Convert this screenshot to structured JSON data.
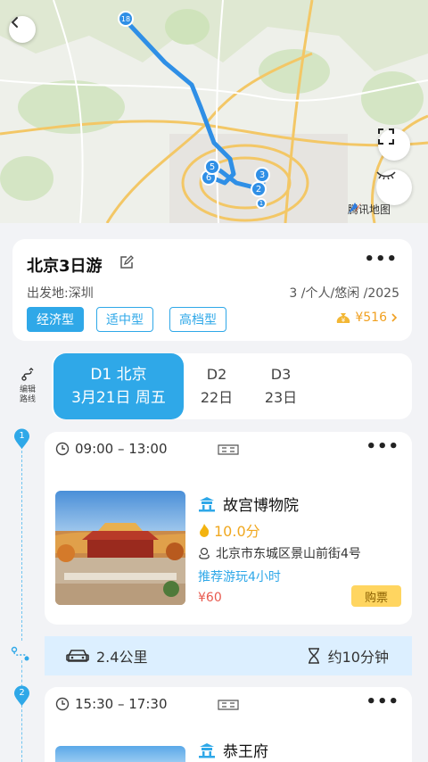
{
  "map": {
    "provider_label": "腾讯地图",
    "route_markers": [
      "6",
      "5",
      "3",
      "2",
      "1"
    ],
    "start_marker": "18"
  },
  "trip": {
    "title": "北京3日游",
    "origin": "出发地:深圳",
    "meta": "3 /个人/悠闲 /2025",
    "tiers": [
      "经济型",
      "适中型",
      "高档型"
    ],
    "budget": "¥516",
    "more": "•••"
  },
  "side": {
    "edit_route_label_1": "编辑",
    "edit_route_label_2": "路线"
  },
  "days": [
    {
      "line1": "D1 北京",
      "line2": "3月21日 周五"
    },
    {
      "line1": "D2",
      "line2": "22日"
    },
    {
      "line1": "D3",
      "line2": "23日"
    }
  ],
  "stops": [
    {
      "index": "1",
      "time": "09:00 – 13:00",
      "name": "故宫博物院",
      "rating": "10.0分",
      "address": "北京市东城区景山前街4号",
      "recommend": "推荐游玩4小时",
      "price": "¥60",
      "buy": "购票"
    },
    {
      "index": "2",
      "time": "15:30 – 17:30",
      "name": "恭王府"
    }
  ],
  "transit": {
    "distance": "2.4公里",
    "duration": "约10分钟"
  },
  "colors": {
    "accent": "#2fa8e8",
    "budget": "#f0a020",
    "price": "#e85a4f",
    "buy": "#ffd560",
    "transit_bg": "#dcefff"
  }
}
